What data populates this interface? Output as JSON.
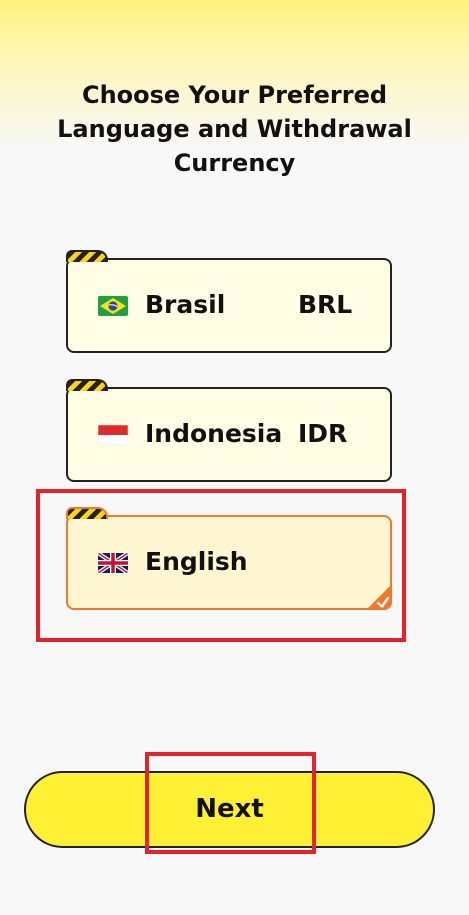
{
  "header": {
    "title": "Choose Your Preferred Language and Withdrawal Currency"
  },
  "options": [
    {
      "name": "Brasil",
      "currency": "BRL",
      "flag": "brazil-flag-icon",
      "selected": false
    },
    {
      "name": "Indonesia",
      "currency": "IDR",
      "flag": "indonesia-flag-icon",
      "selected": false
    },
    {
      "name": "English",
      "currency": "",
      "flag": "uk-flag-icon",
      "selected": true
    }
  ],
  "footer": {
    "next_label": "Next"
  },
  "colors": {
    "accent_yellow": "#fff033",
    "card_background": "#fffde3",
    "selected_border": "#f07a2a",
    "highlight_red": "#e3232c"
  }
}
